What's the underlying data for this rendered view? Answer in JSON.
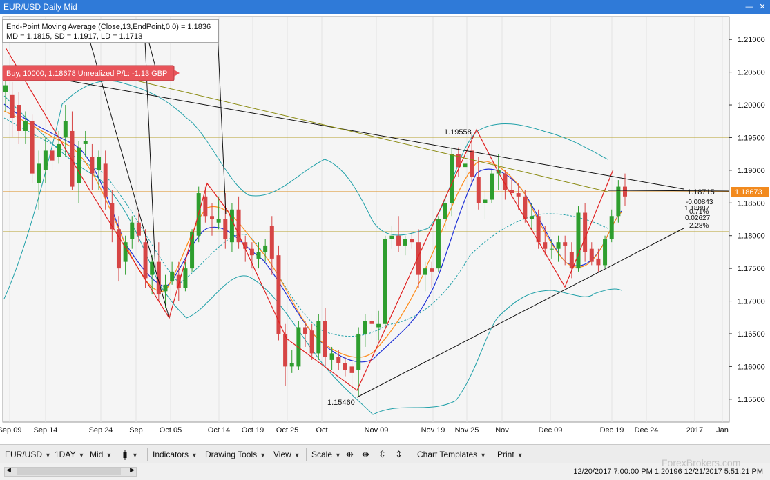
{
  "window": {
    "title": "EUR/USD Daily Mid",
    "minimize": "—",
    "close": "✕"
  },
  "indicator_box": {
    "line1": "End-Point Moving Average (Close,13,EndPoint,0,0) = 1.1836",
    "line2": "MD = 1.1815, SD = 1.1917, LD = 1.1713"
  },
  "position_box": {
    "text": "Buy, 10000, 1.18678 Unrealized P/L: -1.13 GBP"
  },
  "price_scale": [
    "1.21000",
    "1.20500",
    "1.20000",
    "1.19500",
    "1.19000",
    "1.18500",
    "1.18000",
    "1.17500",
    "1.17000",
    "1.16500",
    "1.16000",
    "1.15500"
  ],
  "current_price": "1.18673",
  "date_labels": [
    "Sep 09",
    "Sep 14",
    "Sep 24",
    "Sep",
    "Oct 05",
    "Oct 14",
    "Oct 19",
    "Oct 25",
    "Oct",
    "Nov 09",
    "Nov 19",
    "Nov 25",
    "Nov",
    "Dec 09",
    "Dec 19",
    "Dec 24",
    "2017",
    "Jan"
  ],
  "annotations": {
    "high": "1.19558",
    "low": "1.15460",
    "line_val": "1.18715",
    "stats": [
      "-0.00843",
      "1.18887",
      "0.71%",
      "0.02627",
      "2.28%"
    ]
  },
  "toolbar": {
    "symbol": "EUR/USD",
    "timeframe": "1DAY",
    "price_type": "Mid",
    "indicators": "Indicators",
    "drawing_tools": "Drawing Tools",
    "view": "View",
    "scale": "Scale",
    "chart_templates": "Chart Templates",
    "print": "Print"
  },
  "status": {
    "text": "12/20/2017 7:00:00 PM 1.20196 12/21/2017 5:51:21 PM"
  },
  "watermark": "ForexBrokers.com",
  "colors": {
    "up": "#2e9e2e",
    "down": "#d64545",
    "title_bar": "#2f7ad8",
    "price_tag": "#f28a1e",
    "bollinger": "#20a0a8",
    "ma_blue": "#1d2fd6",
    "ma_orange": "#ff8c1a",
    "zigzag": "#e02020"
  },
  "chart_data": {
    "type": "candlestick",
    "symbol": "EUR/USD",
    "ylim": [
      1.1515,
      1.2135
    ],
    "candles": [
      {
        "o": 1.202,
        "h": 1.206,
        "l": 1.199,
        "c": 1.203
      },
      {
        "o": 1.2015,
        "h": 1.2035,
        "l": 1.195,
        "c": 1.198
      },
      {
        "o": 1.2,
        "h": 1.202,
        "l": 1.194,
        "c": 1.196
      },
      {
        "o": 1.196,
        "h": 1.199,
        "l": 1.194,
        "c": 1.1975
      },
      {
        "o": 1.1975,
        "h": 1.1985,
        "l": 1.188,
        "c": 1.1895
      },
      {
        "o": 1.188,
        "h": 1.193,
        "l": 1.184,
        "c": 1.191
      },
      {
        "o": 1.19,
        "h": 1.195,
        "l": 1.188,
        "c": 1.193
      },
      {
        "o": 1.193,
        "h": 1.1945,
        "l": 1.19,
        "c": 1.1915
      },
      {
        "o": 1.192,
        "h": 1.196,
        "l": 1.191,
        "c": 1.194
      },
      {
        "o": 1.195,
        "h": 1.2,
        "l": 1.192,
        "c": 1.1975
      },
      {
        "o": 1.196,
        "h": 1.199,
        "l": 1.187,
        "c": 1.1875
      },
      {
        "o": 1.188,
        "h": 1.1945,
        "l": 1.185,
        "c": 1.1935
      },
      {
        "o": 1.194,
        "h": 1.196,
        "l": 1.192,
        "c": 1.1945
      },
      {
        "o": 1.192,
        "h": 1.194,
        "l": 1.187,
        "c": 1.1895
      },
      {
        "o": 1.19,
        "h": 1.193,
        "l": 1.187,
        "c": 1.192
      },
      {
        "o": 1.191,
        "h": 1.193,
        "l": 1.184,
        "c": 1.186
      },
      {
        "o": 1.185,
        "h": 1.187,
        "l": 1.179,
        "c": 1.181
      },
      {
        "o": 1.181,
        "h": 1.183,
        "l": 1.173,
        "c": 1.175
      },
      {
        "o": 1.176,
        "h": 1.18,
        "l": 1.174,
        "c": 1.179
      },
      {
        "o": 1.1795,
        "h": 1.183,
        "l": 1.178,
        "c": 1.182
      },
      {
        "o": 1.182,
        "h": 1.1835,
        "l": 1.179,
        "c": 1.18
      },
      {
        "o": 1.179,
        "h": 1.181,
        "l": 1.172,
        "c": 1.1735
      },
      {
        "o": 1.174,
        "h": 1.177,
        "l": 1.171,
        "c": 1.176
      },
      {
        "o": 1.176,
        "h": 1.179,
        "l": 1.17,
        "c": 1.171
      },
      {
        "o": 1.1715,
        "h": 1.174,
        "l": 1.169,
        "c": 1.1725
      },
      {
        "o": 1.173,
        "h": 1.176,
        "l": 1.1725,
        "c": 1.1745
      },
      {
        "o": 1.174,
        "h": 1.176,
        "l": 1.17,
        "c": 1.172
      },
      {
        "o": 1.172,
        "h": 1.176,
        "l": 1.1715,
        "c": 1.175
      },
      {
        "o": 1.175,
        "h": 1.181,
        "l": 1.1745,
        "c": 1.1805
      },
      {
        "o": 1.18,
        "h": 1.1875,
        "l": 1.179,
        "c": 1.1865
      },
      {
        "o": 1.186,
        "h": 1.1875,
        "l": 1.182,
        "c": 1.183
      },
      {
        "o": 1.183,
        "h": 1.185,
        "l": 1.18,
        "c": 1.1825
      },
      {
        "o": 1.182,
        "h": 1.186,
        "l": 1.181,
        "c": 1.1825
      },
      {
        "o": 1.1825,
        "h": 1.1865,
        "l": 1.178,
        "c": 1.1795
      },
      {
        "o": 1.179,
        "h": 1.185,
        "l": 1.1775,
        "c": 1.184
      },
      {
        "o": 1.184,
        "h": 1.186,
        "l": 1.178,
        "c": 1.179
      },
      {
        "o": 1.179,
        "h": 1.18,
        "l": 1.176,
        "c": 1.178
      },
      {
        "o": 1.178,
        "h": 1.179,
        "l": 1.175,
        "c": 1.177
      },
      {
        "o": 1.1765,
        "h": 1.179,
        "l": 1.175,
        "c": 1.1775
      },
      {
        "o": 1.1775,
        "h": 1.1795,
        "l": 1.176,
        "c": 1.1785
      },
      {
        "o": 1.1815,
        "h": 1.183,
        "l": 1.174,
        "c": 1.1765
      },
      {
        "o": 1.177,
        "h": 1.1785,
        "l": 1.164,
        "c": 1.165
      },
      {
        "o": 1.165,
        "h": 1.1665,
        "l": 1.157,
        "c": 1.16
      },
      {
        "o": 1.16,
        "h": 1.1625,
        "l": 1.159,
        "c": 1.1605
      },
      {
        "o": 1.16,
        "h": 1.167,
        "l": 1.1595,
        "c": 1.166
      },
      {
        "o": 1.166,
        "h": 1.167,
        "l": 1.163,
        "c": 1.165
      },
      {
        "o": 1.1655,
        "h": 1.1665,
        "l": 1.161,
        "c": 1.162
      },
      {
        "o": 1.162,
        "h": 1.168,
        "l": 1.161,
        "c": 1.167
      },
      {
        "o": 1.167,
        "h": 1.169,
        "l": 1.16,
        "c": 1.1615
      },
      {
        "o": 1.161,
        "h": 1.163,
        "l": 1.1595,
        "c": 1.162
      },
      {
        "o": 1.1615,
        "h": 1.1625,
        "l": 1.1595,
        "c": 1.1605
      },
      {
        "o": 1.1605,
        "h": 1.1615,
        "l": 1.1585,
        "c": 1.1595
      },
      {
        "o": 1.16,
        "h": 1.161,
        "l": 1.156,
        "c": 1.159
      },
      {
        "o": 1.1595,
        "h": 1.166,
        "l": 1.1555,
        "c": 1.165
      },
      {
        "o": 1.165,
        "h": 1.168,
        "l": 1.163,
        "c": 1.167
      },
      {
        "o": 1.167,
        "h": 1.168,
        "l": 1.164,
        "c": 1.1665
      },
      {
        "o": 1.166,
        "h": 1.1685,
        "l": 1.164,
        "c": 1.1665
      },
      {
        "o": 1.1665,
        "h": 1.18,
        "l": 1.166,
        "c": 1.1795
      },
      {
        "o": 1.1795,
        "h": 1.1815,
        "l": 1.178,
        "c": 1.18
      },
      {
        "o": 1.18,
        "h": 1.183,
        "l": 1.1775,
        "c": 1.1785
      },
      {
        "o": 1.1785,
        "h": 1.18,
        "l": 1.177,
        "c": 1.1795
      },
      {
        "o": 1.1795,
        "h": 1.1805,
        "l": 1.178,
        "c": 1.179
      },
      {
        "o": 1.179,
        "h": 1.181,
        "l": 1.172,
        "c": 1.174
      },
      {
        "o": 1.174,
        "h": 1.176,
        "l": 1.1715,
        "c": 1.175
      },
      {
        "o": 1.175,
        "h": 1.176,
        "l": 1.172,
        "c": 1.1745
      },
      {
        "o": 1.175,
        "h": 1.183,
        "l": 1.1745,
        "c": 1.1825
      },
      {
        "o": 1.1825,
        "h": 1.186,
        "l": 1.181,
        "c": 1.185
      },
      {
        "o": 1.185,
        "h": 1.1935,
        "l": 1.183,
        "c": 1.1925
      },
      {
        "o": 1.1925,
        "h": 1.1935,
        "l": 1.189,
        "c": 1.1905
      },
      {
        "o": 1.1905,
        "h": 1.192,
        "l": 1.188,
        "c": 1.191
      },
      {
        "o": 1.193,
        "h": 1.1955,
        "l": 1.188,
        "c": 1.189
      },
      {
        "o": 1.189,
        "h": 1.192,
        "l": 1.184,
        "c": 1.185
      },
      {
        "o": 1.185,
        "h": 1.187,
        "l": 1.1825,
        "c": 1.1855
      },
      {
        "o": 1.1855,
        "h": 1.19,
        "l": 1.185,
        "c": 1.1895
      },
      {
        "o": 1.1895,
        "h": 1.1925,
        "l": 1.187,
        "c": 1.19
      },
      {
        "o": 1.1895,
        "h": 1.19,
        "l": 1.1855,
        "c": 1.187
      },
      {
        "o": 1.187,
        "h": 1.189,
        "l": 1.186,
        "c": 1.1865
      },
      {
        "o": 1.1865,
        "h": 1.188,
        "l": 1.184,
        "c": 1.186
      },
      {
        "o": 1.186,
        "h": 1.187,
        "l": 1.182,
        "c": 1.1825
      },
      {
        "o": 1.1825,
        "h": 1.185,
        "l": 1.181,
        "c": 1.183
      },
      {
        "o": 1.183,
        "h": 1.184,
        "l": 1.178,
        "c": 1.179
      },
      {
        "o": 1.179,
        "h": 1.1815,
        "l": 1.177,
        "c": 1.178
      },
      {
        "o": 1.178,
        "h": 1.1795,
        "l": 1.1765,
        "c": 1.178
      },
      {
        "o": 1.178,
        "h": 1.18,
        "l": 1.176,
        "c": 1.179
      },
      {
        "o": 1.179,
        "h": 1.18,
        "l": 1.1755,
        "c": 1.1785
      },
      {
        "o": 1.1775,
        "h": 1.179,
        "l": 1.1735,
        "c": 1.175
      },
      {
        "o": 1.175,
        "h": 1.1845,
        "l": 1.1745,
        "c": 1.1835
      },
      {
        "o": 1.1835,
        "h": 1.185,
        "l": 1.176,
        "c": 1.1775
      },
      {
        "o": 1.178,
        "h": 1.179,
        "l": 1.1755,
        "c": 1.176
      },
      {
        "o": 1.1765,
        "h": 1.178,
        "l": 1.1745,
        "c": 1.1755
      },
      {
        "o": 1.1755,
        "h": 1.18,
        "l": 1.175,
        "c": 1.1795
      },
      {
        "o": 1.1795,
        "h": 1.184,
        "l": 1.179,
        "c": 1.183
      },
      {
        "o": 1.183,
        "h": 1.1885,
        "l": 1.182,
        "c": 1.1875
      },
      {
        "o": 1.1875,
        "h": 1.1895,
        "l": 1.1845,
        "c": 1.186
      }
    ]
  }
}
